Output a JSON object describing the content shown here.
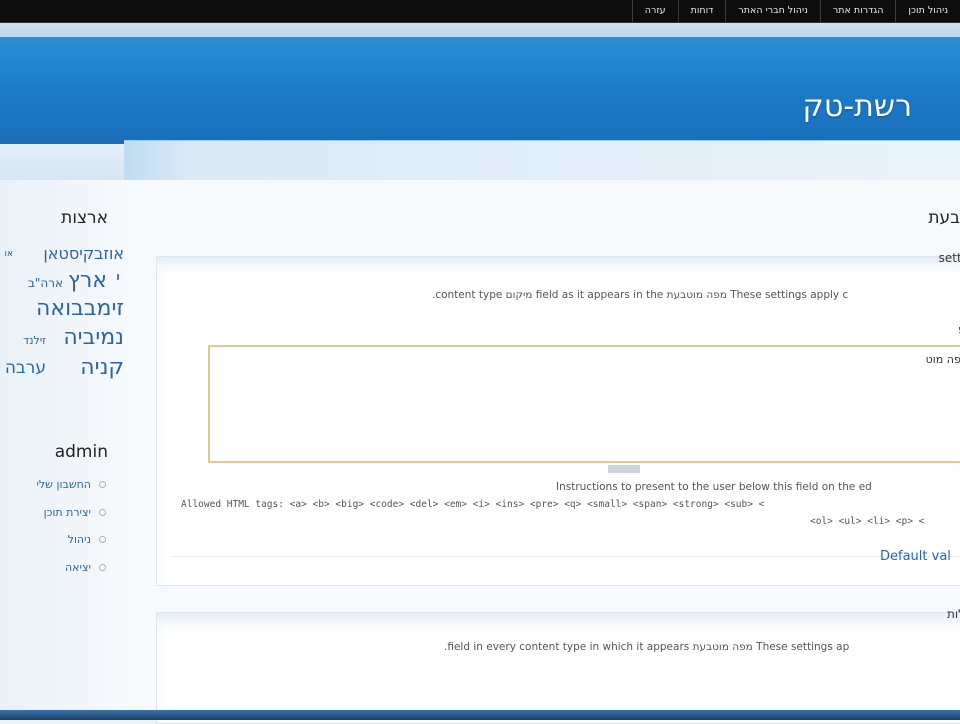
{
  "topbar": {
    "items": [
      "ניהול תוכן",
      "הגדרות אתר",
      "ניהול חברי האתר",
      "דוחות",
      "עזרה"
    ]
  },
  "header": {
    "site_name": "רשת-טק"
  },
  "sidebar": {
    "tags_title": "ארצות",
    "tags": [
      {
        "text": "אוזבקיסטאן",
        "size": 16
      },
      {
        "text": "או",
        "size": 9
      },
      {
        "text": "ארה\"ב",
        "size": 12
      },
      {
        "text": "ארץ",
        "size": 22
      },
      {
        "text": "י",
        "size": 18
      },
      {
        "text": "זימבבואה",
        "size": 22
      },
      {
        "text": "זילנד",
        "size": 11
      },
      {
        "text": "נמיביה",
        "size": 22
      },
      {
        "text": "ערבה",
        "size": 17
      },
      {
        "text": "קניה",
        "size": 22
      }
    ],
    "admin_title": "admin",
    "admin_menu": [
      "החשבון שלי",
      "יצירת תוכן",
      "ניהול",
      "יציאה"
    ]
  },
  "content": {
    "page_title": "בעת",
    "fieldset1": {
      "legend": "setti",
      "description": ".content type מיקום field as it appears in the מפה מוטבעת These settings apply c",
      "label": "פ",
      "textarea_value": "ר מפה מוט",
      "help_text": "Instructions to present to the user below this field on the ed",
      "allowed_tags_line1": "Allowed HTML tags: <a> <b> <big> <code> <del> <em> <i> <ins> <pre> <q> <small> <span> <strong> <sub> <",
      "allowed_tags_line2": "<ol> <ul> <li> <p> <",
      "default_link": "Default val"
    },
    "fieldset2": {
      "legend": "לות",
      "description": ".field in every content type in which it appears מפה מוטבעת These settings ap"
    }
  }
}
